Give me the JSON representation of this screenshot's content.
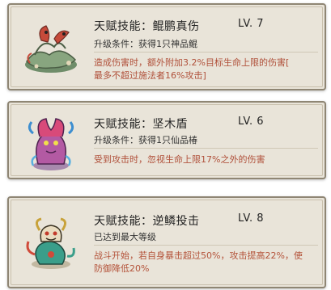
{
  "talents": [
    {
      "title": "天赋技能：鲲鹏真伤",
      "level": "LV. 7",
      "condition": "升级条件：获得1只神品鲲",
      "desc_lines": [
        "造成伤害时，额外附加3.2%目标生命上限的伤害[",
        "最多不超过施法者16%攻击]"
      ],
      "portrait_icon": "kunpeng-creature-icon"
    },
    {
      "title": "天赋技能：坚木盾",
      "level": "LV. 6",
      "condition": "升级条件：获得1只仙品椿",
      "desc_lines": [
        "受到攻击时，忽视生命上限17%之外的伤害"
      ],
      "portrait_icon": "chun-tree-spirit-icon"
    },
    {
      "title": "天赋技能：逆鳞投击",
      "level": "LV. 8",
      "condition": "已达到最大等级",
      "desc_lines": [
        "战斗开始，若自身暴击超过50%，攻击提高22%，使",
        "防御降低20%"
      ],
      "portrait_icon": "dragon-creature-icon"
    }
  ],
  "colors": {
    "card_bg": "#e9e4d9",
    "card_border": "#8f8674",
    "desc_text": "#b0503a"
  }
}
